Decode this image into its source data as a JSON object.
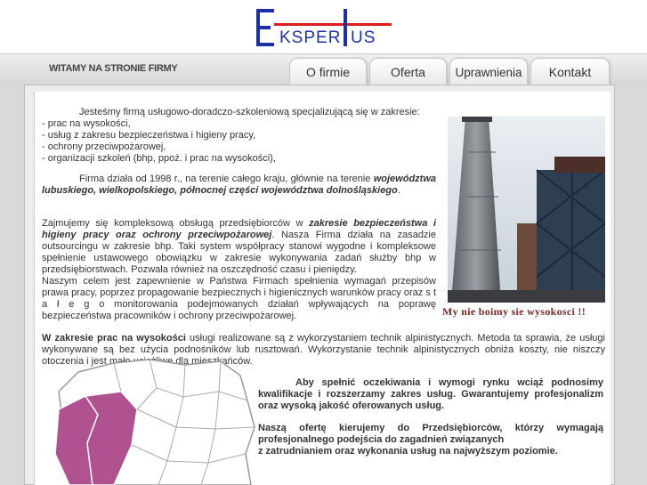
{
  "header": {
    "logo_letter_e": "E",
    "logo_word_1": "KSPER",
    "logo_letter_t": "T",
    "logo_word_2": "US",
    "colors": {
      "logo_blue": "#1f2fa8",
      "logo_red": "#e01a1a"
    }
  },
  "welcome": "WITAMY NA STRONIE FIRMY",
  "nav": {
    "tabs": [
      {
        "label": "O firmie"
      },
      {
        "label": "Oferta"
      },
      {
        "label": "Uprawnienia"
      },
      {
        "label": "Kontakt"
      }
    ]
  },
  "content": {
    "intro": "Jesteśmy firmą usługowo-doradczo-szkoleniową specjalizującą się w zakresie:",
    "services": [
      "- prac na wysokości,",
      "- usług z zakresu bezpieczeństwa i higieny pracy,",
      "- ochrony przeciwpożarowej,",
      "- organizacji szkoleń (bhp, ppoż. i prac na wysokości),"
    ],
    "p2_start": "Firma działa od 1998 r., na terenie całego kraju, głównie na terenie",
    "p2_regions": "województwa lubuskiego, wielkopolskiego, północnej części województwa dolnośląskiego",
    "p2_end": ".",
    "p3_start": "Zajmujemy się kompleksową obsługą przedsiębiorców w",
    "p3_bold": "zakresie bezpieczeństwa i higieny pracy oraz ochrony przeciwpożarowej",
    "p3_rest": ". Nasza Firma działa na zasadzie outsourcingu w zakresie bhp. Taki system współpracy stanowi wygodne i kompleksowe spełnienie ustawowego obowiązku w zakresie wykonywania zadań służby bhp w przedsiębiorstwach. Pozwala również na oszczędność czasu i pieniędzy.",
    "p4": "Naszym celem jest zapewnienie w Państwa Firmach spełnienia wymagań przepisów prawa pracy, poprzez propagowanie bezpiecznych i higienicznych warunków pracy oraz s t a ł e g o monitorowania podejmowanych działań wpływających na poprawę bezpieczeństwa pracowników i ochrony przeciwpożarowej.",
    "photo_caption": "My nie boimy sie wysokosci !!",
    "p5_bold": "W zakresie prac na wysokości",
    "p5_rest": " usługi realizowane są z wykorzystaniem technik alpinistycznych. Metoda ta sprawia, że usługi wykonywane są bez użycia podnośników lub rusztowań. Wykorzystanie technik alpinistycznych obniża koszty, nie niszczy otoczenia i jest mało uciążliwe dla mieszkańców.",
    "p6": "Aby spełnić oczekiwania i wymogi rynku wciąż podnosimy kwalifikacje i rozszerzamy zakres usług. Gwarantujemy profesjonalizm oraz wysoką jakość oferowanych usług.",
    "p7_line1": "Naszą ofertę kierujemy do Przedsiębiorców, którzy wymagają profesjonalnego podejścia do zagadnień związanych",
    "p7_line2": "z zatrudnianiem oraz wykonania usług na najwyższym poziomie."
  },
  "map": {
    "highlight_color": "#b0528f"
  }
}
